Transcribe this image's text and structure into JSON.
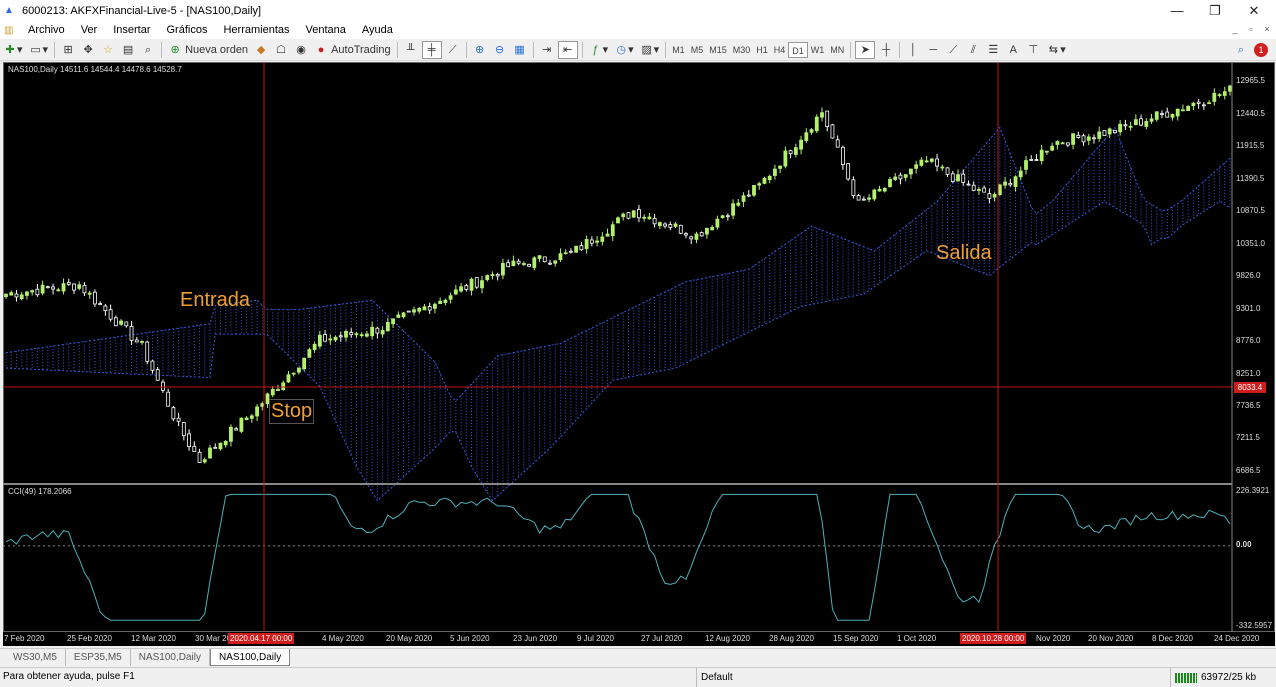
{
  "window": {
    "title": "6000213: AKFXFinancial-Live-5 - [NAS100,Daily]",
    "minimize": "—",
    "restore": "❐",
    "close": "✕"
  },
  "menu": [
    "Archivo",
    "Ver",
    "Insertar",
    "Gráficos",
    "Herramientas",
    "Ventana",
    "Ayuda"
  ],
  "mdi": {
    "minimize": "_",
    "restore": "▫",
    "close": "×"
  },
  "toolbar": {
    "new_order": "Nueva orden",
    "autotrading": "AutoTrading",
    "timeframes": [
      "M1",
      "M5",
      "M15",
      "M30",
      "H1",
      "H4",
      "D1",
      "W1",
      "MN"
    ],
    "active_timeframe": "D1",
    "notification_count": "1"
  },
  "chart": {
    "symbol_info": "NAS100,Daily  14511.6 14544.4 14478.6 14528.7",
    "indicator_info": "CCI(49) 178.2066",
    "annotations": {
      "entry": "Entrada",
      "exit": "Salida",
      "stop": "Stop"
    },
    "current_price_label": "8033.4",
    "crosshair_time_1": "2020.04.17 00:00",
    "crosshair_time_2": "2020.10.28 00:00",
    "price_ticks": [
      "12965.5",
      "12440.5",
      "11915.5",
      "11390.5",
      "10870.5",
      "10351.0",
      "9826.0",
      "9301.0",
      "8776.0",
      "8251.0",
      "7736.5",
      "7211.5",
      "6686.5"
    ],
    "cci_ticks": [
      "226.3921",
      "0.00",
      "-332.5957"
    ],
    "time_ticks": [
      "7 Feb 2020",
      "25 Feb 2020",
      "12 Mar 2020",
      "30 Mar 2020",
      "4 May 2020",
      "20 May 2020",
      "5 Jun 2020",
      "23 Jun 2020",
      "9 Jul 2020",
      "27 Jul 2020",
      "12 Aug 2020",
      "28 Aug 2020",
      "15 Sep 2020",
      "1 Oct 2020",
      "Nov 2020",
      "20 Nov 2020",
      "8 Dec 2020",
      "24 Dec 2020"
    ],
    "colors": {
      "background": "#000000",
      "bull": "#b4f070",
      "bear": "#ffffff",
      "cloud": "#3a58d8",
      "crosshair": "#c01818",
      "cci": "#4fb0b8"
    }
  },
  "chart_data": {
    "type": "candlestick",
    "title": "NAS100,Daily",
    "ylim": [
      6500,
      13200
    ],
    "closes_by_week": [
      {
        "x": "7 Feb 2020",
        "y": 9520
      },
      {
        "x": "25 Feb 2020",
        "y": 8600
      },
      {
        "x": "12 Mar 2020",
        "y": 7500
      },
      {
        "x": "23 Mar 2020",
        "y": 6900
      },
      {
        "x": "30 Mar 2020",
        "y": 7700
      },
      {
        "x": "17 Apr 2020",
        "y": 8800
      },
      {
        "x": "4 May 2020",
        "y": 9000
      },
      {
        "x": "20 May 2020",
        "y": 9500
      },
      {
        "x": "5 Jun 2020",
        "y": 9950
      },
      {
        "x": "23 Jun 2020",
        "y": 10200
      },
      {
        "x": "9 Jul 2020",
        "y": 10800
      },
      {
        "x": "27 Jul 2020",
        "y": 10600
      },
      {
        "x": "12 Aug 2020",
        "y": 11200
      },
      {
        "x": "28 Aug 2020",
        "y": 12200
      },
      {
        "x": "15 Sep 2020",
        "y": 11000
      },
      {
        "x": "1 Oct 2020",
        "y": 11600
      },
      {
        "x": "28 Oct 2020",
        "y": 11300
      },
      {
        "x": "20 Nov 2020",
        "y": 12000
      },
      {
        "x": "8 Dec 2020",
        "y": 12500
      },
      {
        "x": "24 Dec 2020",
        "y": 12800
      }
    ],
    "cci_range": [
      -332.5957,
      226.3921
    ]
  },
  "tabs": [
    "WS30,M5",
    "ESP35,M5",
    "NAS100,Daily",
    "NAS100,Daily"
  ],
  "active_tab": 3,
  "status": {
    "help": "Para obtener ayuda, pulse F1",
    "profile": "Default",
    "traffic": "63972/25 kb"
  }
}
